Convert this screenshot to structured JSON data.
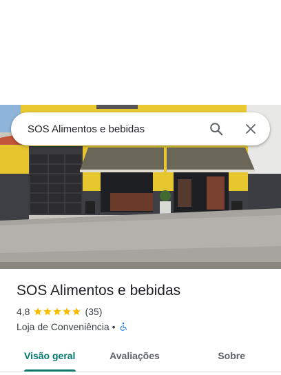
{
  "search": {
    "query": "SOS Alimentos e bebidas"
  },
  "place": {
    "name": "SOS Alimentos e bebidas",
    "rating": "4,8",
    "stars": 5,
    "reviews": "(35)",
    "category": "Loja de Conveniência",
    "separator": "•"
  },
  "tabs": [
    {
      "label": "Visão geral",
      "active": true
    },
    {
      "label": "Avaliações",
      "active": false
    },
    {
      "label": "Sobre",
      "active": false
    }
  ],
  "icons": {
    "search": "search-icon",
    "close": "close-icon",
    "star": "star-icon",
    "accessibility": "wheelchair-icon"
  },
  "colors": {
    "accent": "#00796b",
    "star": "#fbbc04",
    "accessibility": "#1a73e8"
  }
}
